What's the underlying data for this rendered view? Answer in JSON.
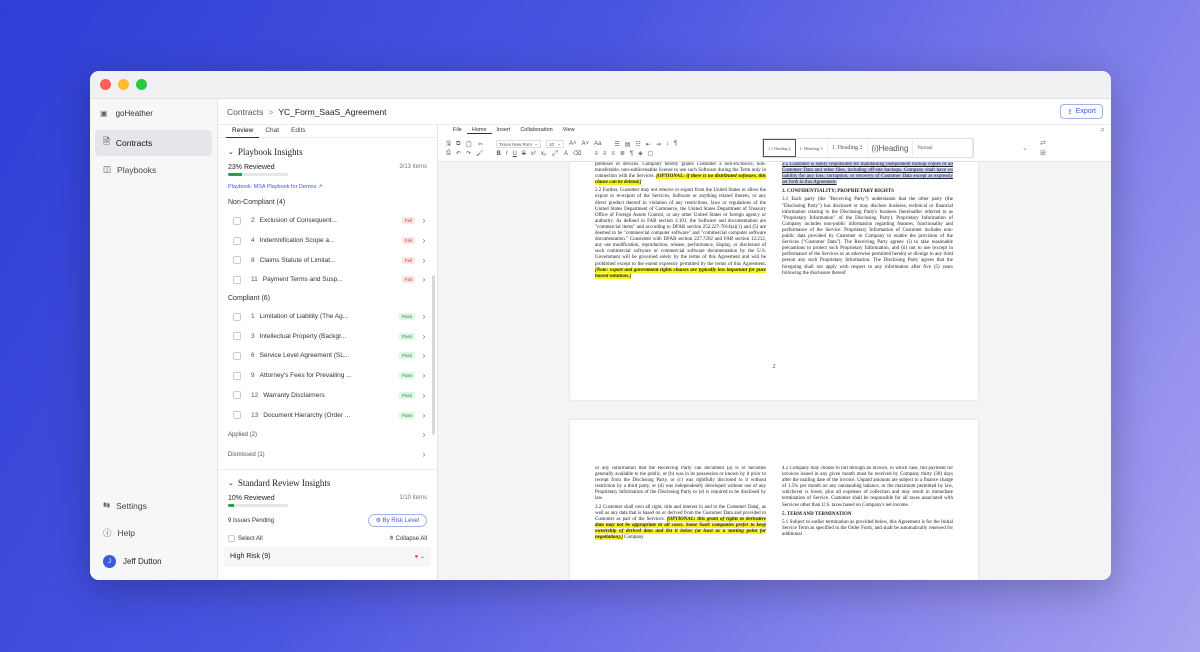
{
  "sidebar": {
    "brand": "goHeather",
    "nav": [
      {
        "label": "Contracts",
        "active": true
      },
      {
        "label": "Playbooks",
        "active": false
      }
    ],
    "bottom": [
      {
        "label": "Settings"
      },
      {
        "label": "Help"
      }
    ],
    "user": {
      "name": "Jeff Dutton",
      "initial": "J"
    }
  },
  "header": {
    "breadcrumb_root": "Contracts",
    "breadcrumb_sep": ">",
    "breadcrumb_current": "YC_Form_SaaS_Agreement",
    "export_label": "Export"
  },
  "panel": {
    "tabs": [
      {
        "label": "Review",
        "active": true
      },
      {
        "label": "Chat"
      },
      {
        "label": "Edits"
      }
    ],
    "playbook": {
      "title": "Playbook Insights",
      "reviewed": "23% Reviewed",
      "progress": 0.23,
      "count": "3/13 items",
      "link": "Playbook: MSA Playbook for Demos",
      "non_compliant_title": "Non-Compliant (4)",
      "non_compliant": [
        {
          "num": "2",
          "text": "Exclusion of Consequent...",
          "status": "Fail"
        },
        {
          "num": "4",
          "text": "Indemnification Scope a...",
          "status": "Fail"
        },
        {
          "num": "8",
          "text": "Claims Statute of Limitat...",
          "status": "Fail"
        },
        {
          "num": "11",
          "text": "Payment Terms and Susp...",
          "status": "Fail"
        }
      ],
      "compliant_title": "Compliant (6)",
      "compliant": [
        {
          "num": "1",
          "text": "Limitation of Liability (The Ag...",
          "status": "Pass"
        },
        {
          "num": "3",
          "text": "Intellectual Property (Backgr...",
          "status": "Pass"
        },
        {
          "num": "6",
          "text": "Service Level Agreement (SL...",
          "status": "Pass"
        },
        {
          "num": "9",
          "text": "Attorney's Fees for Prevailing ...",
          "status": "Pass"
        },
        {
          "num": "12",
          "text": "Warranty Disclaimers",
          "status": "Pass"
        },
        {
          "num": "13",
          "text": "Document Hierarchy (Order ...",
          "status": "Pass"
        }
      ],
      "applied": "Applied (2)",
      "dismissed": "Dismissed (1)"
    },
    "standard": {
      "title": "Standard Review Insights",
      "reviewed": "10% Reviewed",
      "progress": 0.1,
      "count": "1/10 items",
      "pending": "9 Issues Pending",
      "risk_button": "By Risk Level",
      "select_all": "Select All",
      "collapse_all": "Collapse All",
      "high_risk": "High Risk (9)"
    }
  },
  "editor": {
    "menus": [
      {
        "label": "File"
      },
      {
        "label": "Home",
        "active": true
      },
      {
        "label": "Insert"
      },
      {
        "label": "Collaboration"
      },
      {
        "label": "View"
      }
    ],
    "font": "Times New Rom",
    "size": "10",
    "styles": [
      "1.1 Heading 4",
      "1. Heading 3",
      "1. Heading 2",
      "(i)Heading",
      "Normal"
    ],
    "page1": {
      "left_top": "premises or devices. Company hereby grants Customer a non-exclusive, non-transferable, non-sublicensable license to use such Software during the Term only in connection with the Services.",
      "left_hl": "[OPTIONAL: if there is no distributed software, this clause can be deleted.]",
      "left_2_2": "2.2 Further, Customer may not remove or export from the United States or allow the export or re-export of the Services, Software or anything related thereto, or any direct product thereof in violation of any restrictions, laws or regulations of the United States Department of Commerce, the United States Department of Treasury Office of Foreign Assets Control, or any other United States or foreign agency or authority. As defined in FAR section 2.101, the Software and documentation are \"commercial items\" and according to DFAR section 252.227-7014(a)(1) and (5) are deemed to be \"commercial computer software\" and \"commercial computer software documentation.\" Consistent with DFAR section 227.7202 and FAR section 12.212, any use modification, reproduction, release, performance, display, or disclosure of such commercial software or commercial software documentation by the U.S. Government will be governed solely by the terms of this Agreement and will be prohibited except to the extent expressly permitted by the terms of this Agreement.",
      "left_hl2": "[Note: export and government rights clauses are typically less important for pure hosted solutions.]",
      "right_2_5": "2.5 Customer is solely responsible for maintaining independent backup copies of all Customer Data and other files, including off-site backups. Company shall have no liability for any loss, corruption, or recovery of Customer Data except as expressly set forth in this Agreement.",
      "right_h3": "3. CONFIDENTIALITY; PROPRIETARY RIGHTS",
      "right_3_1": "3.1 Each party (the \"Receiving Party\") understands that the other party (the \"Disclosing Party\") has disclosed or may disclose business, technical or financial information relating to the Disclosing Party's business (hereinafter referred to as \"Proprietary Information\" of the Disclosing Party). Proprietary Information of Company includes non-public information regarding features, functionality and performance of the Service. Proprietary Information of Customer includes non-public data provided by Customer to Company to enable the provision of the Services (\"Customer Data\"). The Receiving Party agrees: (i) to take reasonable precautions to protect such Proprietary Information, and (ii) not to use (except in performance of the Services or as otherwise permitted herein) or divulge to any third person any such Proprietary Information. The Disclosing Party agrees that the foregoing shall not apply with respect to any information after five (5) years following the disclosure thereof",
      "page_number": "2"
    },
    "page2": {
      "left_top": "or any information that the Receiving Party can document (a) is or becomes generally available to the public, or (b) was in its possession or known by it prior to receipt from the Disclosing Party, or (c) was rightfully disclosed to it without restriction by a third party, or (d) was independently developed without use of any Proprietary Information of the Disclosing Party or (e) is required to be disclosed by law.",
      "left_3_2": "3.2 Customer shall own all right, title and interest in and to the Customer Data[, as well as any data that is based on or derived from the Customer Data and provided to Customer as part of the Services.",
      "left_hl": "[OPTIONAL: this grant of rights to derivative data may not be appropriate in all cases. Some SaaS companies prefer to keep ownership of derived data and list it below (at least as a starting point for negotiation).]",
      "left_tail": "Company",
      "right_4_2": "4.2 Company may choose to bill through an invoice, in which case, full payment for invoices issued in any given month must be received by Company thirty (30) days after the mailing date of the invoice. Unpaid amounts are subject to a finance charge of 1.5% per month on any outstanding balance, or the maximum permitted by law, whichever is lower, plus all expenses of collection and may result in immediate termination of Service. Customer shall be responsible for all taxes associated with Services other than U.S. taxes based on Company's net income.",
      "right_h5": "5. TERM AND TERMINATION",
      "right_5_1": "5.1 Subject to earlier termination as provided below, this Agreement is for the Initial Service Term as specified in the Order Form, and shall be automatically renewed for additional"
    }
  }
}
